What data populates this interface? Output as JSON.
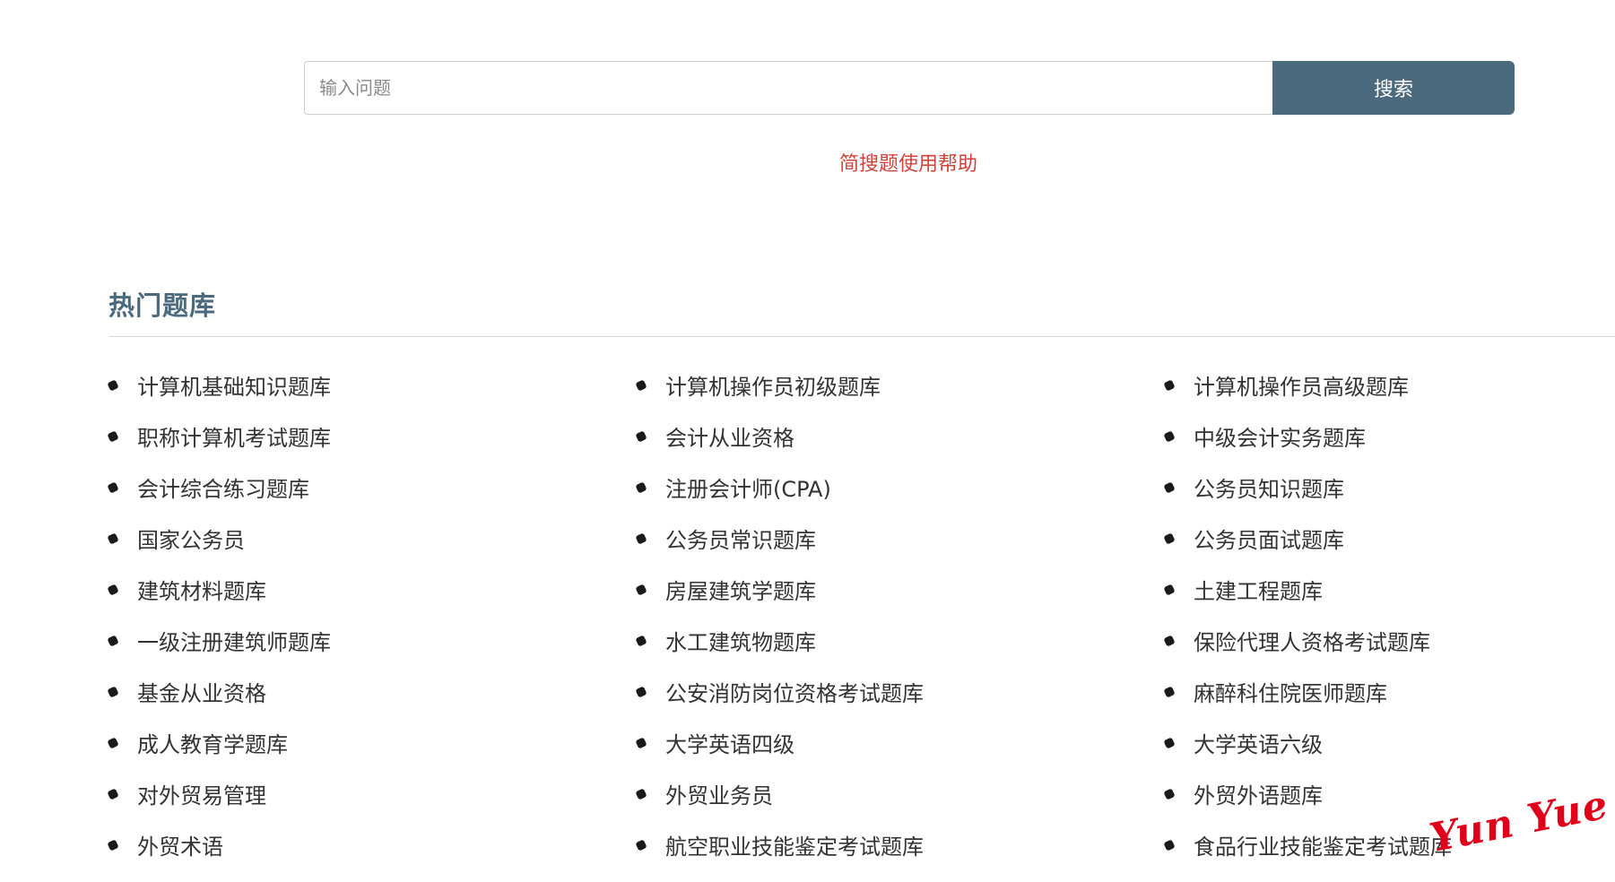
{
  "search": {
    "placeholder": "输入问题",
    "value": "",
    "button_label": "搜索"
  },
  "help_link": "简搜题使用帮助",
  "hot_section": {
    "title": "热门题库",
    "items": [
      "计算机基础知识题库",
      "计算机操作员初级题库",
      "计算机操作员高级题库",
      "职称计算机考试题库",
      "会计从业资格",
      "中级会计实务题库",
      "会计综合练习题库",
      "注册会计师(CPA)",
      "公务员知识题库",
      "国家公务员",
      "公务员常识题库",
      "公务员面试题库",
      "建筑材料题库",
      "房屋建筑学题库",
      "土建工程题库",
      "一级注册建筑师题库",
      "水工建筑物题库",
      "保险代理人资格考试题库",
      "基金从业资格",
      "公安消防岗位资格考试题库",
      "麻醉科住院医师题库",
      "成人教育学题库",
      "大学英语四级",
      "大学英语六级",
      "对外贸易管理",
      "外贸业务员",
      "外贸外语题库",
      "外贸术语",
      "航空职业技能鉴定考试题库",
      "食品行业技能鉴定考试题库"
    ]
  },
  "watermark": "Yun Yue",
  "colors": {
    "accent": "#4c6a7d",
    "help_link": "#d0433a",
    "watermark": "#e1001a"
  }
}
